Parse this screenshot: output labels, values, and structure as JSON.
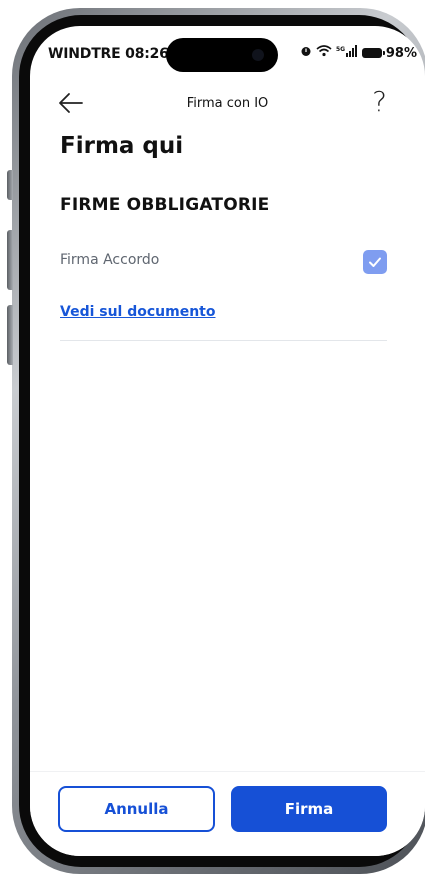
{
  "status_bar": {
    "carrier_time": "WINDTRE 08:26",
    "network": "5G",
    "battery": "98%"
  },
  "nav": {
    "title": "Firma con IO",
    "help_label": "?"
  },
  "page": {
    "title": "Firma qui",
    "section_title": "FIRME OBBLIGATORIE",
    "signature_label": "Firma Accordo",
    "signature_checked": true,
    "link_text": "Vedi sul documento"
  },
  "footer": {
    "cancel_label": "Annulla",
    "sign_label": "Firma"
  },
  "colors": {
    "primary": "#1650d6",
    "checkbox": "#7f9df0",
    "muted_text": "#5f6670"
  },
  "icons": {
    "back": "arrow-left-icon",
    "help": "question-mark-icon",
    "check": "check-icon",
    "wifi": "wifi-icon",
    "signal": "signal-icon",
    "battery": "battery-icon",
    "alarm": "alarm-icon"
  }
}
